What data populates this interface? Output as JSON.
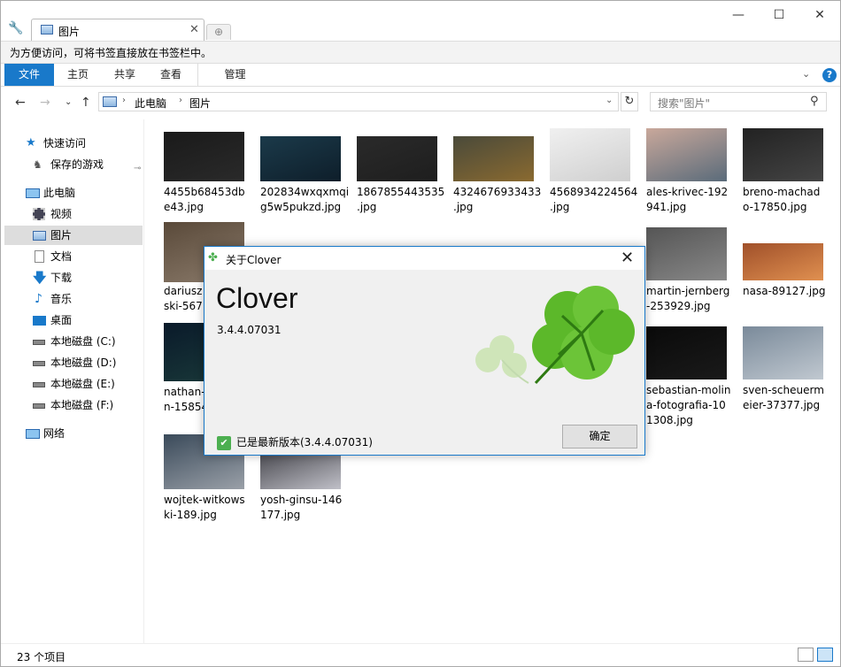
{
  "window": {
    "tab_label": "图片",
    "tab_close": "✕",
    "new_tab": "⊕",
    "minimize": "—",
    "maximize": "☐",
    "close": "✕"
  },
  "bookmark_bar": {
    "text": "为方便访问，可将书签直接放在书签栏中。"
  },
  "ribbon": {
    "tabs": [
      "文件",
      "主页",
      "共享",
      "查看",
      "管理"
    ],
    "expand": "⌄",
    "help": "?"
  },
  "nav": {
    "back": "←",
    "forward": "→",
    "recent": "⌄",
    "up": "↑",
    "crumbs": [
      "此电脑",
      "图片"
    ],
    "crumb_sep": "›",
    "dropdown": "⌄",
    "refresh": "↻",
    "search_placeholder": "搜索\"图片\"",
    "search_icon": "⚲"
  },
  "sidebar": {
    "items": [
      {
        "label": "快速访问",
        "icon": "star-icon"
      },
      {
        "label": "保存的游戏",
        "icon": "game-icon"
      },
      {
        "label": "此电脑",
        "icon": "computer-icon"
      },
      {
        "label": "视频",
        "icon": "video-icon"
      },
      {
        "label": "图片",
        "icon": "pictures-icon"
      },
      {
        "label": "文档",
        "icon": "document-icon"
      },
      {
        "label": "下载",
        "icon": "download-icon"
      },
      {
        "label": "音乐",
        "icon": "music-icon"
      },
      {
        "label": "桌面",
        "icon": "desktop-icon"
      },
      {
        "label": "本地磁盘 (C:)",
        "icon": "drive-icon"
      },
      {
        "label": "本地磁盘 (D:)",
        "icon": "drive-icon"
      },
      {
        "label": "本地磁盘 (E:)",
        "icon": "drive-icon"
      },
      {
        "label": "本地磁盘 (F:)",
        "icon": "drive-icon"
      },
      {
        "label": "网络",
        "icon": "network-icon"
      }
    ],
    "pin": "📌"
  },
  "files": [
    {
      "line1": "4455b68453db",
      "line2": "e43.jpg",
      "colors": [
        "#1a1a1a",
        "#2a2a2a"
      ]
    },
    {
      "line1": "202834wxqxmqi",
      "line2": "g5w5pukzd.jpg",
      "colors": [
        "#1b3a4a",
        "#0e1e2a"
      ]
    },
    {
      "line1": "1867855443535",
      "line2": ".jpg",
      "colors": [
        "#2a2a2a",
        "#1e1e1e"
      ]
    },
    {
      "line1": "4324676933433",
      "line2": ".jpg",
      "colors": [
        "#4a4a3a",
        "#8a6a30"
      ]
    },
    {
      "line1": "4568934224564",
      "line2": ".jpg",
      "colors": [
        "#f0f0f0",
        "#cfcfcf"
      ]
    },
    {
      "line1": "ales-krivec-192",
      "line2": "941.jpg",
      "colors": [
        "#c9a89b",
        "#5a6b7a"
      ]
    },
    {
      "line1": "breno-machad",
      "line2": "o-17850.jpg",
      "colors": [
        "#222",
        "#444"
      ]
    },
    {
      "line1": "dariusz",
      "line2": "ski-567",
      "colors": [
        "#5a4a3a",
        "#8a7a6a"
      ]
    },
    {
      "line1": "martin-jernberg",
      "line2": "-253929.jpg",
      "colors": [
        "#555",
        "#888"
      ]
    },
    {
      "line1": "nasa-89127.jpg",
      "line2": "",
      "colors": [
        "#a0502a",
        "#e09050"
      ]
    },
    {
      "line1": "nathan-",
      "line2": "n-15854",
      "colors": [
        "#0a1a2a",
        "#1a3a3a"
      ]
    },
    {
      "line1": "sebastian-molin",
      "line2": "a-fotografia-10",
      "line3": "1308.jpg",
      "colors": [
        "#0a0a0a",
        "#1a1a1a"
      ]
    },
    {
      "line1": "sven-scheuerm",
      "line2": "eier-37377.jpg",
      "colors": [
        "#7a8a9a",
        "#c0c8d0"
      ]
    },
    {
      "line1": "wojtek-witkows",
      "line2": "ki-189.jpg",
      "colors": [
        "#3a4a5a",
        "#9aa0a8"
      ]
    },
    {
      "line1": "yosh-ginsu-146",
      "line2": "177.jpg",
      "colors": [
        "#2a2a30",
        "#c0c0c8"
      ]
    }
  ],
  "status": {
    "count": "23 个项目"
  },
  "dialog": {
    "title": "关于Clover",
    "close": "✕",
    "app_name": "Clover",
    "version": "3.4.4.07031",
    "status_text": "已是最新版本(3.4.4.07031)",
    "status_icon": "✔",
    "ok_label": "确定",
    "title_icon": "✤"
  },
  "colors": {
    "accent": "#1979ca",
    "clover_dark": "#5cb82a",
    "clover_light": "#a8d878"
  }
}
